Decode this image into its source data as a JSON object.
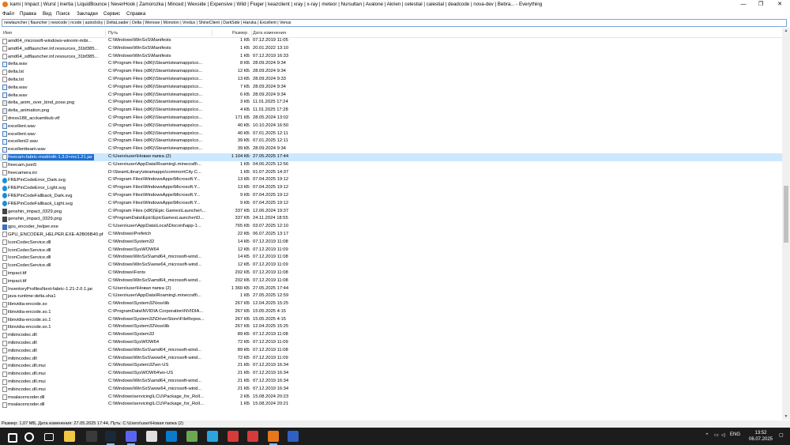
{
  "window": {
    "title": "kami | Impact | Wurst | inertia | LiquidBounce | NeverHook | Zamorozka | Minced | Wexside | Expensive | Wild | Fluger | keazclient | xray | x-ray | meteor | Nursultan | Avalone | Akrien | celestial | calestial | deadcode | nova-dev | Bebra... - Everything",
    "minimize": "—",
    "maximize": "❐",
    "close": "✕"
  },
  "menu": [
    "Файл",
    "Правка",
    "Вид",
    "Поиск",
    "Закладки",
    "Сервис",
    "Справка"
  ],
  "search": {
    "value": "newlauncher | flauncher | newcode | ncode | autoclicky | DeltaLoader | Delta | Wenose | Monoton | Vredux | ShineClient | DarkSide | Haruka | Excellent | Venus"
  },
  "columns": {
    "name": "Имя",
    "path": "Путь",
    "size": "Размер",
    "date": "Дата изменения"
  },
  "rows": [
    {
      "icon": "doc",
      "name": "amd64_microsoft-windows-winomi-mibi...",
      "path": "C:\\Windows\\WinSxS\\Manifests",
      "size": "1 КБ",
      "date": "07.12.2019 11:05"
    },
    {
      "icon": "doc",
      "name": "amd64_sdflauncher.inf.resources_31bf385...",
      "path": "C:\\Windows\\WinSxS\\Manifests",
      "size": "1 КБ",
      "date": "20.01.2022 13:10"
    },
    {
      "icon": "doc",
      "name": "amd64_sdflauncher.inf.resources_31bf385...",
      "path": "C:\\Windows\\WinSxS\\Manifests",
      "size": "1 КБ",
      "date": "07.12.2019 16:33"
    },
    {
      "icon": "audio",
      "name": "delta.wav",
      "path": "C:\\Program Files (x86)\\Steam\\steamapps\\co...",
      "size": "8 КБ",
      "date": "28.09.2024 9:34"
    },
    {
      "icon": "doc",
      "name": "delta.lst",
      "path": "C:\\Program Files (x86)\\Steam\\steamapps\\co...",
      "size": "12 КБ",
      "date": "28.09.2024 9:34"
    },
    {
      "icon": "doc",
      "name": "delta.lst",
      "path": "C:\\Program Files (x86)\\Steam\\steamapps\\co...",
      "size": "13 КБ",
      "date": "28.09.2024 9:33"
    },
    {
      "icon": "audio",
      "name": "delta.wav",
      "path": "C:\\Program Files (x86)\\Steam\\steamapps\\co...",
      "size": "7 КБ",
      "date": "28.09.2024 9:34"
    },
    {
      "icon": "audio",
      "name": "delta.wav",
      "path": "C:\\Program Files (x86)\\Steam\\steamapps\\co...",
      "size": "6 КБ",
      "date": "28.09.2024 9:34"
    },
    {
      "icon": "img",
      "name": "delta_anim_over_bind_pose.png",
      "path": "C:\\Program Files (x86)\\Steam\\steamapps\\co...",
      "size": "3 КБ",
      "date": "11.01.2025 17:24"
    },
    {
      "icon": "img",
      "name": "delta_animation.png",
      "path": "C:\\Program Files (x86)\\Steam\\steamapps\\co...",
      "size": "4 КБ",
      "date": "11.01.2025 17:28"
    },
    {
      "icon": "doc",
      "name": "dress188_acckamikub.vtf",
      "path": "C:\\Program Files (x86)\\Steam\\steamapps\\co...",
      "size": "171 КБ",
      "date": "28.05.2024 13:02"
    },
    {
      "icon": "audio",
      "name": "excellent.wav",
      "path": "C:\\Program Files (x86)\\Steam\\steamapps\\co...",
      "size": "40 КБ",
      "date": "10.10.2024 16:50"
    },
    {
      "icon": "audio",
      "name": "excellent.wav",
      "path": "C:\\Program Files (x86)\\Steam\\steamapps\\co...",
      "size": "40 КБ",
      "date": "07.01.2025 12:11"
    },
    {
      "icon": "audio",
      "name": "excellent2.wav",
      "path": "C:\\Program Files (x86)\\Steam\\steamapps\\co...",
      "size": "39 КБ",
      "date": "07.01.2025 12:11"
    },
    {
      "icon": "audio",
      "name": "excellentteam.wav",
      "path": "C:\\Program Files (x86)\\Steam\\steamapps\\co...",
      "size": "39 КБ",
      "date": "28.09.2024 9:34"
    },
    {
      "icon": "doc",
      "name": "freecam-fabric-modrinth-1.3.0+mc1.21.jar",
      "path": "C:\\Users\\user\\Новая папка (2)",
      "size": "1 104 КБ",
      "date": "27.05.2025 17:44",
      "selected": true
    },
    {
      "icon": "doc",
      "name": "freecam.json5",
      "path": "C:\\Users\\user\\AppData\\Roaming\\.minecraft\\...",
      "size": "1 КБ",
      "date": "04.06.2025 12:56"
    },
    {
      "icon": "doc",
      "name": "freecamera.ini",
      "path": "D:\\SteamLibrary\\steamapps\\common\\City C...",
      "size": "1 КБ",
      "date": "01.07.2025 14:37"
    },
    {
      "icon": "edge",
      "name": "FREPinCodeError_Dark.svg",
      "path": "C:\\Program Files\\WindowsApps\\Microsoft.Y...",
      "size": "13 КБ",
      "date": "07.04.2025 19:12"
    },
    {
      "icon": "edge",
      "name": "FREPinCodeError_Light.svg",
      "path": "C:\\Program Files\\WindowsApps\\Microsoft.Y...",
      "size": "13 КБ",
      "date": "07.04.2025 19:12"
    },
    {
      "icon": "edge",
      "name": "FREPinCodeFallback_Dark.svg",
      "path": "C:\\Program Files\\WindowsApps\\Microsoft.Y...",
      "size": "9 КБ",
      "date": "07.04.2025 19:12"
    },
    {
      "icon": "edge",
      "name": "FREPinCodeFallback_Light.svg",
      "path": "C:\\Program Files\\WindowsApps\\Microsoft.Y...",
      "size": "9 КБ",
      "date": "07.04.2025 19:12"
    },
    {
      "icon": "genshin",
      "name": "genshin_impact_0329.png",
      "path": "C:\\Program Files (x86)\\Epic Games\\Launcher\\...",
      "size": "337 КБ",
      "date": "12.06.2024 19:37"
    },
    {
      "icon": "genshin",
      "name": "genshin_impact_0329.png",
      "path": "C:\\ProgramData\\Epic\\EpicGamesLauncher\\D...",
      "size": "337 КБ",
      "date": "24.11.2024 18:55"
    },
    {
      "icon": "app",
      "name": "gpu_encoder_helper.exe",
      "path": "C:\\Users\\user\\AppData\\Local\\Discord\\app-1...",
      "size": "765 КБ",
      "date": "03.07.2025 12:10"
    },
    {
      "icon": "doc",
      "name": "GPU_ENCODER_HELPER.EXE-A2B06B40.pf",
      "path": "C:\\Windows\\Prefetch",
      "size": "22 КБ",
      "date": "06.07.2025 13:17"
    },
    {
      "icon": "doc",
      "name": "IconCodecService.dll",
      "path": "C:\\Windows\\System32",
      "size": "14 КБ",
      "date": "07.12.2019 11:08"
    },
    {
      "icon": "doc",
      "name": "IconCodecService.dll",
      "path": "C:\\Windows\\SysWOW64",
      "size": "12 КБ",
      "date": "07.12.2019 11:09"
    },
    {
      "icon": "doc",
      "name": "IconCodecService.dll",
      "path": "C:\\Windows\\WinSxS\\amd64_microsoft-wind...",
      "size": "14 КБ",
      "date": "07.12.2019 11:08"
    },
    {
      "icon": "doc",
      "name": "IconCodecService.dll",
      "path": "C:\\Windows\\WinSxS\\wow64_microsoft-wind...",
      "size": "12 КБ",
      "date": "07.12.2019 11:09"
    },
    {
      "icon": "doc",
      "name": "impact.ttf",
      "path": "C:\\Windows\\Fonts",
      "size": "202 КБ",
      "date": "07.12.2019 11:08"
    },
    {
      "icon": "doc",
      "name": "impact.ttf",
      "path": "C:\\Windows\\WinSxS\\amd64_microsoft-wind...",
      "size": "202 КБ",
      "date": "07.12.2019 11:08"
    },
    {
      "icon": "doc",
      "name": "InventoryProfilesNext-fabric-1.21-2.0.1.jar",
      "path": "C:\\Users\\user\\Новая папка (2)",
      "size": "1 360 КБ",
      "date": "27.05.2025 17:44"
    },
    {
      "icon": "doc",
      "name": "java-runtime-delta.sha1",
      "path": "C:\\Users\\user\\AppData\\Roaming\\.minecraft\\...",
      "size": "1 КБ",
      "date": "27.05.2025 12:59"
    },
    {
      "icon": "doc",
      "name": "libnvidia-encode.so",
      "path": "C:\\Windows\\System32\\lxss\\lib",
      "size": "267 КБ",
      "date": "12.04.2025 15:25"
    },
    {
      "icon": "doc",
      "name": "libnvidia-encode.so.1",
      "path": "C:\\ProgramData\\NVIDIA Corporation\\NVIDIA...",
      "size": "267 КБ",
      "date": "15.05.2025 4:15"
    },
    {
      "icon": "doc",
      "name": "libnvidia-encode.so.1",
      "path": "C:\\Windows\\System32\\DriverStore\\FileRepos...",
      "size": "267 КБ",
      "date": "15.05.2025 4:15"
    },
    {
      "icon": "doc",
      "name": "libnvidia-encode.so.1",
      "path": "C:\\Windows\\System32\\lxss\\lib",
      "size": "267 КБ",
      "date": "12.04.2025 15:25"
    },
    {
      "icon": "doc",
      "name": "mibincodec.dll",
      "path": "C:\\Windows\\System32",
      "size": "89 КБ",
      "date": "07.12.2019 11:08"
    },
    {
      "icon": "doc",
      "name": "mibincodec.dll",
      "path": "C:\\Windows\\SysWOW64",
      "size": "72 КБ",
      "date": "07.12.2019 11:09"
    },
    {
      "icon": "doc",
      "name": "mibincodec.dll",
      "path": "C:\\Windows\\WinSxS\\amd64_microsoft-wind...",
      "size": "89 КБ",
      "date": "07.12.2019 11:08"
    },
    {
      "icon": "doc",
      "name": "mibincodec.dll",
      "path": "C:\\Windows\\WinSxS\\wow64_microsoft-wind...",
      "size": "72 КБ",
      "date": "07.12.2019 11:09"
    },
    {
      "icon": "doc",
      "name": "mibincodec.dll.mui",
      "path": "C:\\Windows\\System32\\en-US",
      "size": "21 КБ",
      "date": "07.12.2019 16:34"
    },
    {
      "icon": "doc",
      "name": "mibincodec.dll.mui",
      "path": "C:\\Windows\\SysWOW64\\en-US",
      "size": "21 КБ",
      "date": "07.12.2019 16:34"
    },
    {
      "icon": "doc",
      "name": "mibincodec.dll.mui",
      "path": "C:\\Windows\\WinSxS\\amd64_microsoft-wind...",
      "size": "21 КБ",
      "date": "07.12.2019 16:34"
    },
    {
      "icon": "doc",
      "name": "mibincodec.dll.mui",
      "path": "C:\\Windows\\WinSxS\\wow64_microsoft-wind...",
      "size": "21 КБ",
      "date": "07.12.2019 16:34"
    },
    {
      "icon": "doc",
      "name": "msalacencoder.dll",
      "path": "C:\\Windows\\servicing\\LCU\\Package_for_Roll...",
      "size": "2 КБ",
      "date": "15.08.2024 20:23"
    },
    {
      "icon": "doc",
      "name": "msalacencoder.dll",
      "path": "C:\\Windows\\servicing\\LCU\\Package_for_Roll...",
      "size": "1 КБ",
      "date": "15.08.2024 20:21"
    }
  ],
  "status": "Размер: 1,07 МБ, Дата изменения: 27.05.2025 17:44, Путь: C:\\Users\\user\\Новая папка (2)",
  "taskbar": {
    "lang": "ENG",
    "time": "13:52",
    "date": "06.07.2025",
    "icons": [
      {
        "name": "start-icon",
        "color": "#ffffff"
      },
      {
        "name": "search-icon",
        "color": "#ffffff"
      },
      {
        "name": "task-view-icon",
        "color": "#ffffff"
      },
      {
        "name": "file-explorer-icon",
        "color": "#f2c744"
      },
      {
        "name": "terminal-icon",
        "color": "#3a3a3a"
      },
      {
        "name": "steam-icon",
        "color": "#1b2838"
      },
      {
        "name": "discord-icon",
        "color": "#5865f2"
      },
      {
        "name": "chrome-icon",
        "color": "#e0e0e0"
      },
      {
        "name": "vscode-icon",
        "color": "#0a7acc"
      },
      {
        "name": "minecraft-icon",
        "color": "#6aa84f"
      },
      {
        "name": "telegram-icon",
        "color": "#2aa3df"
      },
      {
        "name": "app-red-icon",
        "color": "#d63a3a"
      },
      {
        "name": "app-red2-icon",
        "color": "#d63a3a"
      },
      {
        "name": "everything-icon",
        "color": "#e8771c"
      },
      {
        "name": "app-blue-icon",
        "color": "#3060c0"
      }
    ]
  }
}
